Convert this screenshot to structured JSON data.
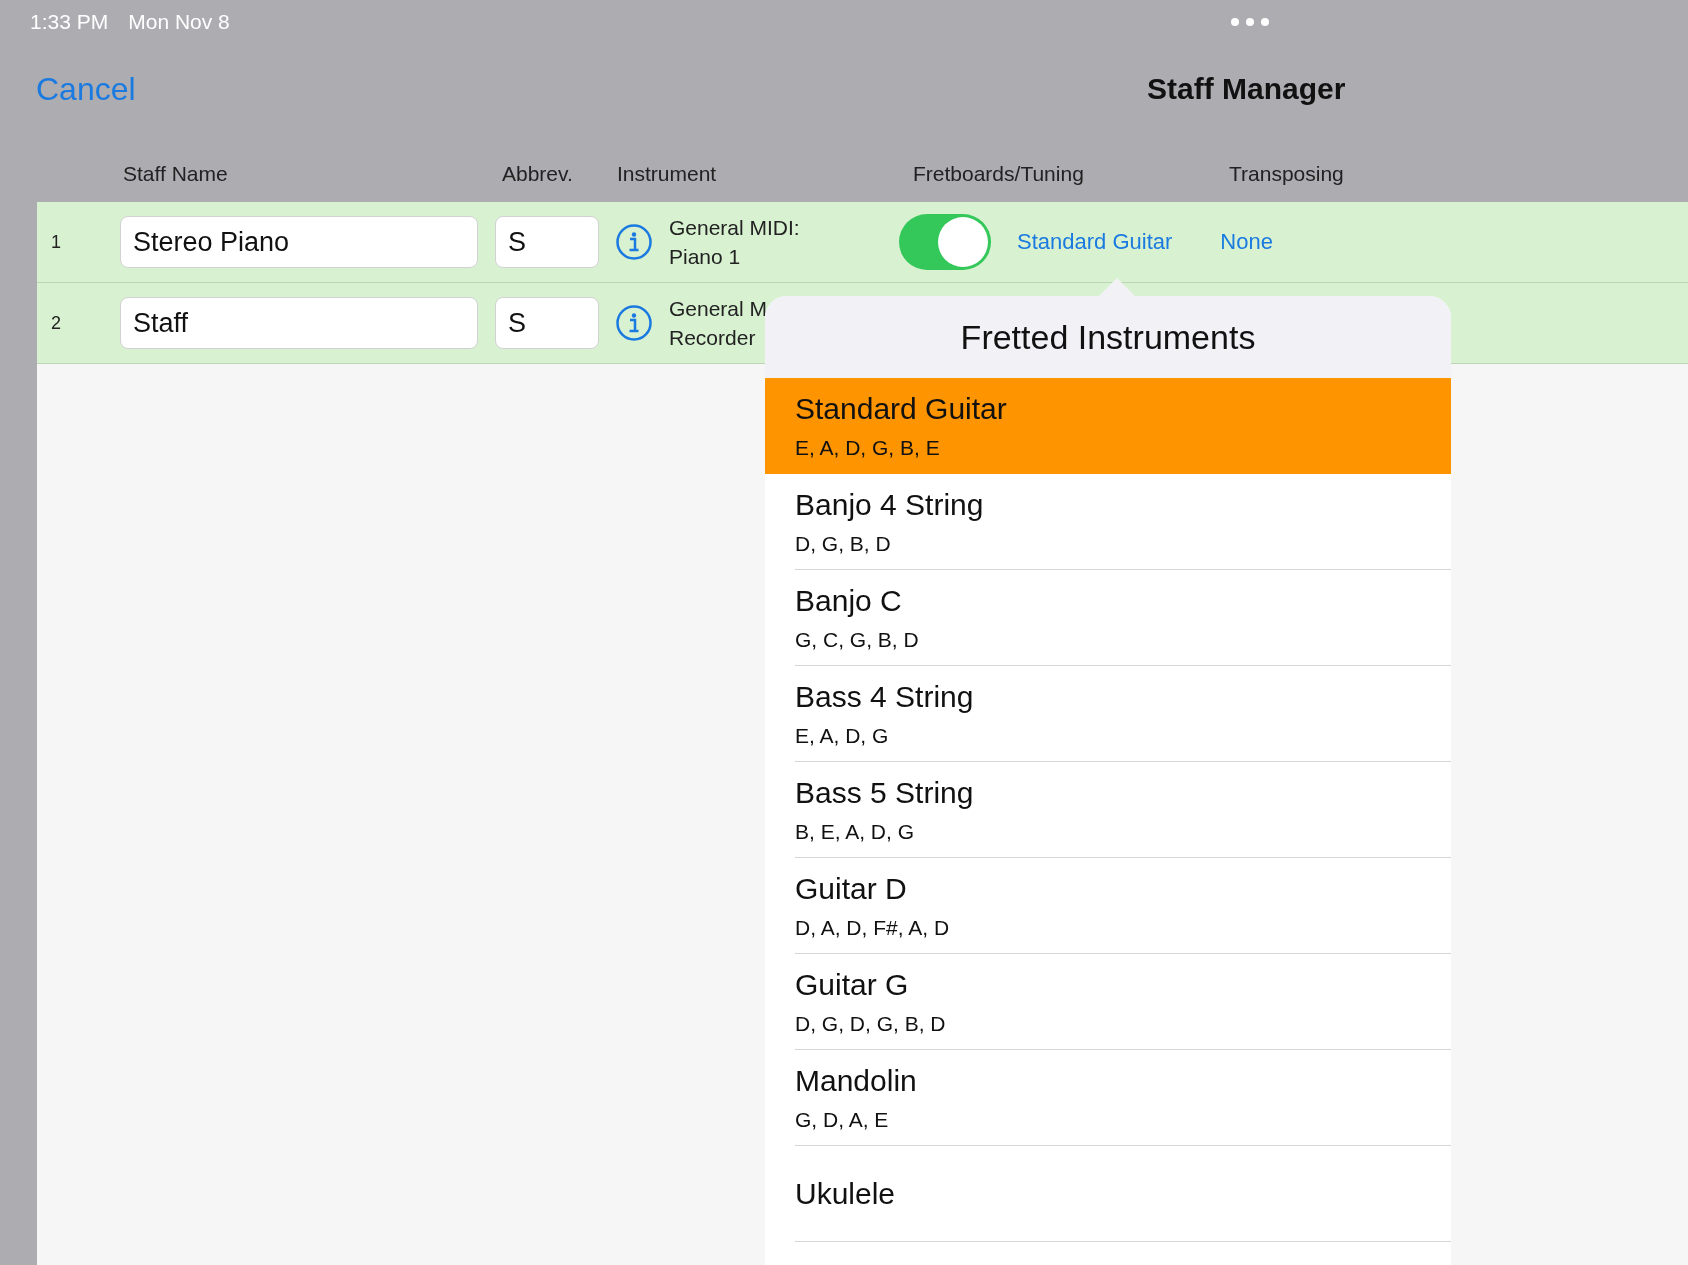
{
  "status_bar": {
    "time": "1:33 PM",
    "date": "Mon Nov 8"
  },
  "nav": {
    "cancel": "Cancel",
    "title": "Staff Manager"
  },
  "columns": [
    "Staff Name",
    "Abbrev.",
    "Instrument",
    "Fretboards/Tuning",
    "Transposing"
  ],
  "rows": [
    {
      "number": "1",
      "name": "Stereo Piano",
      "abbrev": "S",
      "instrument": [
        "General MIDI:",
        "Piano 1"
      ],
      "fretboard": {
        "on": true,
        "tuning": "Standard Guitar"
      },
      "transposing": "None"
    },
    {
      "number": "2",
      "name": "Staff",
      "abbrev": "S",
      "instrument": [
        "General M",
        "Recorder"
      ]
    }
  ],
  "popover": {
    "title": "Fretted Instruments",
    "items": [
      {
        "name": "Standard Guitar",
        "tuning": "E, A, D, G, B, E",
        "selected": true
      },
      {
        "name": "Banjo 4 String",
        "tuning": "D, G, B, D",
        "selected": false
      },
      {
        "name": "Banjo C",
        "tuning": "G, C, G, B, D",
        "selected": false
      },
      {
        "name": "Bass 4 String",
        "tuning": "E, A, D, G",
        "selected": false
      },
      {
        "name": "Bass 5 String",
        "tuning": "B, E, A, D, G",
        "selected": false
      },
      {
        "name": "Guitar D",
        "tuning": "D, A, D, F#, A, D",
        "selected": false
      },
      {
        "name": "Guitar G",
        "tuning": "D, G, D, G, B, D",
        "selected": false
      },
      {
        "name": "Mandolin",
        "tuning": "G, D, A, E",
        "selected": false
      },
      {
        "name": "Ukulele",
        "selected": false
      }
    ]
  }
}
